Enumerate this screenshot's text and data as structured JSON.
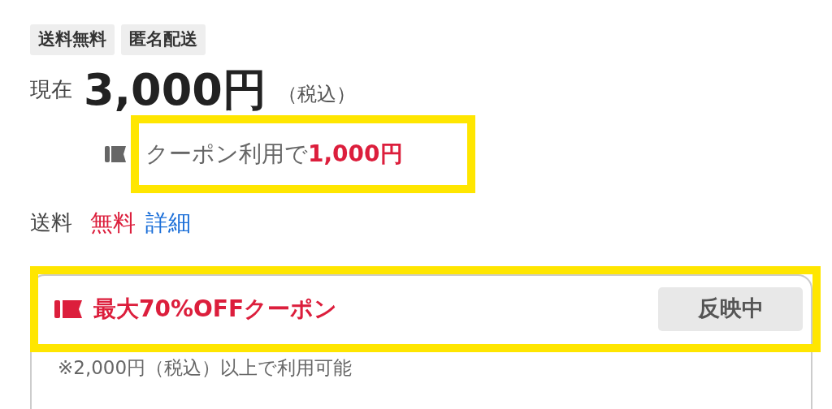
{
  "tags": [
    "送料無料",
    "匿名配送"
  ],
  "price": {
    "label": "現在",
    "amount": "3,000円",
    "tax_note": "（税込）"
  },
  "coupon_price": {
    "text": "クーポン利用で",
    "amount": "1,000円"
  },
  "shipping": {
    "label": "送料",
    "value": "無料",
    "link": "詳細"
  },
  "coupon": {
    "title": "最大70%OFFクーポン",
    "button": "反映中",
    "condition": "※2,000円（税込）以上で利用可能"
  }
}
